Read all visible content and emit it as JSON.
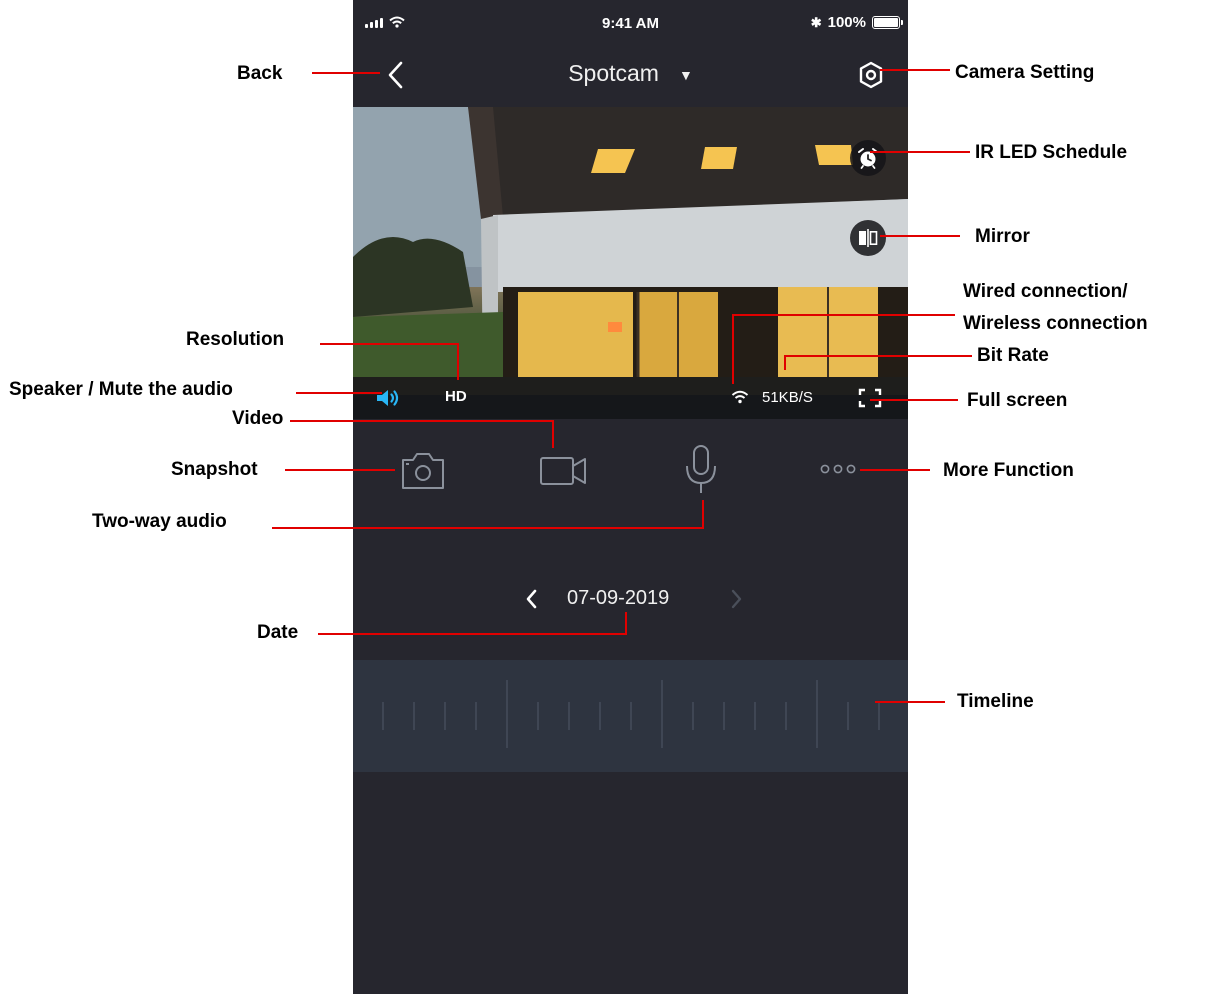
{
  "status_bar": {
    "time": "9:41 AM",
    "battery": "100%",
    "bluetooth_symbol": "✱"
  },
  "nav": {
    "title": "Spotcam",
    "caret": "▼"
  },
  "video": {
    "resolution": "HD",
    "bit_rate": "51KB/S"
  },
  "date": {
    "value": "07-09-2019"
  },
  "annotations": {
    "back": "Back",
    "camera_setting": "Camera Setting",
    "ir_led_schedule": "IR LED Schedule",
    "mirror": "Mirror",
    "connection_line1": "Wired connection/",
    "connection_line2": "Wireless connection",
    "bit_rate": "Bit Rate",
    "full_screen": "Full screen",
    "resolution": "Resolution",
    "speaker": "Speaker / Mute the audio",
    "video": "Video",
    "snapshot": "Snapshot",
    "more_function": "More Function",
    "two_way_audio": "Two-way audio",
    "date": "Date",
    "timeline": "Timeline"
  },
  "colors": {
    "app_bg": "#26262e",
    "timeline_bg": "#2e3440",
    "accent_blue": "#29b6f6",
    "annotation_line": "#e00000"
  },
  "icons": [
    "back-arrow",
    "caret-down",
    "settings-hexagon",
    "alarm-clock",
    "mirror",
    "speaker",
    "wifi",
    "fullscreen",
    "camera",
    "video-camera",
    "microphone",
    "more-dots"
  ]
}
